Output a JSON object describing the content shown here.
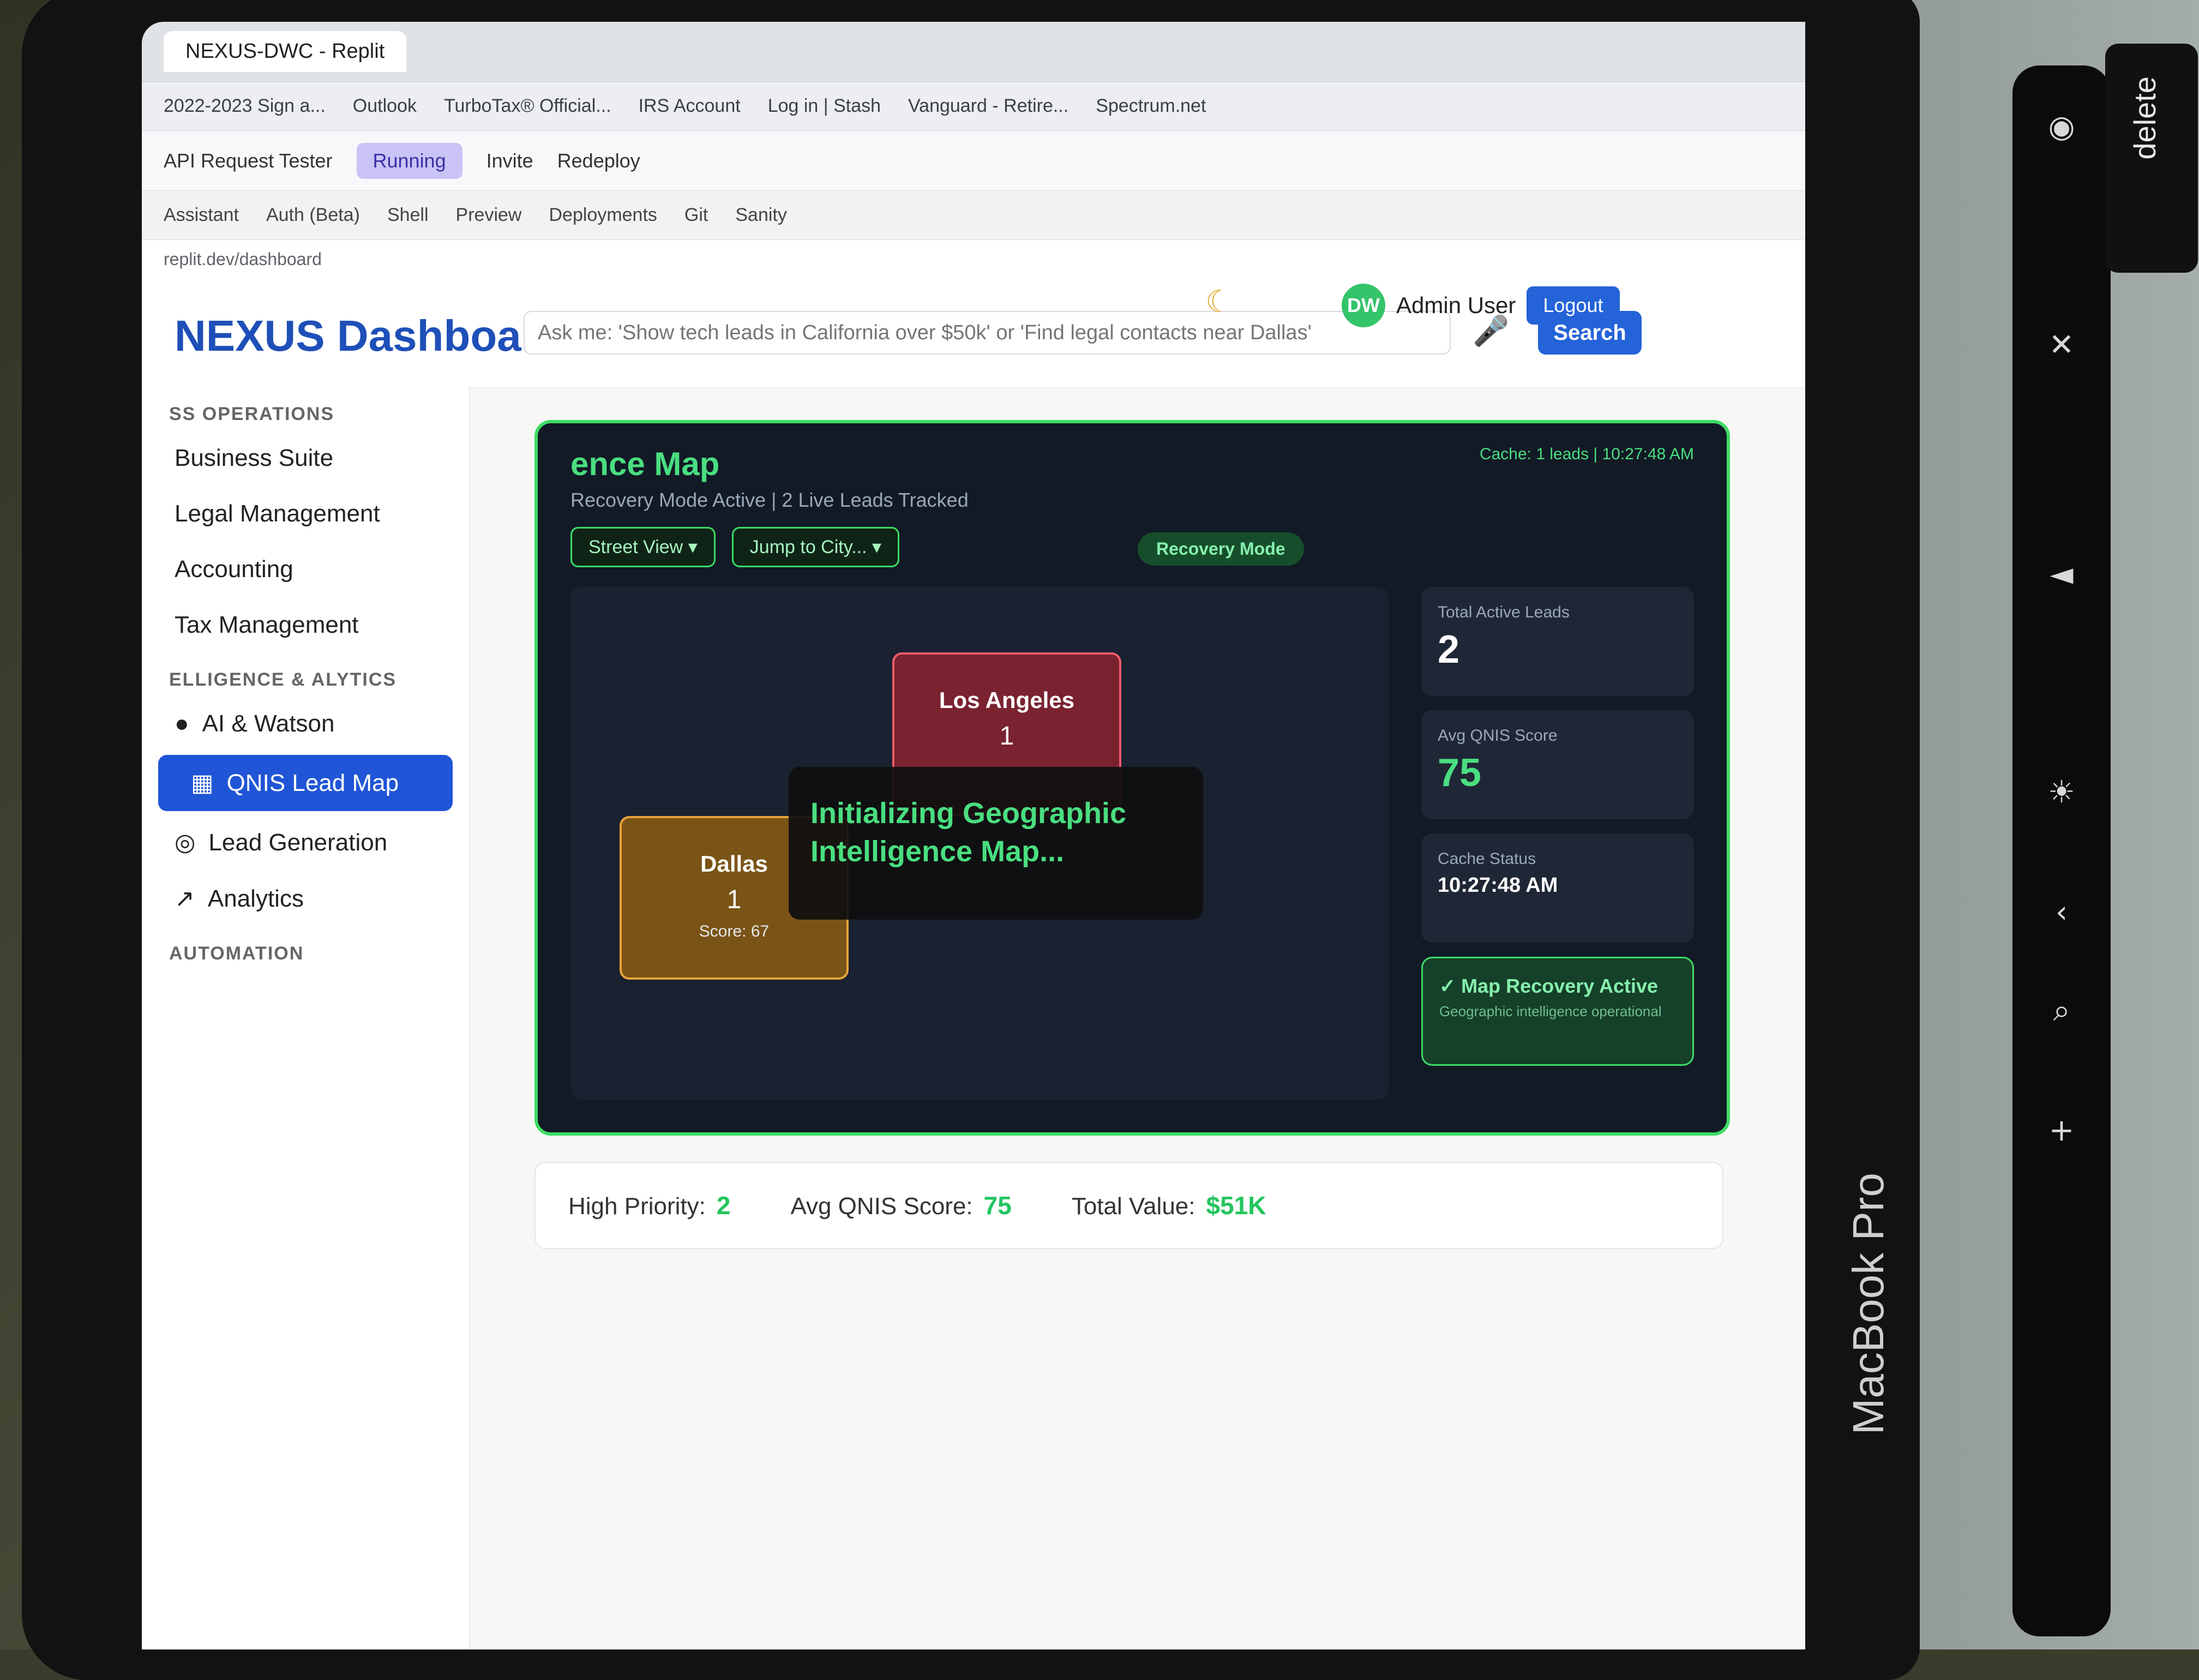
{
  "browser": {
    "tab_title": "NEXUS-DWC - Replit",
    "bookmarks": [
      "2022-2023 Sign a...",
      "Outlook",
      "TurboTax® Official...",
      "IRS Account",
      "Log in | Stash",
      "Vanguard - Retire...",
      "Spectrum.net"
    ],
    "url": "replit.dev/dashboard"
  },
  "replit": {
    "project": "API Request Tester",
    "status": "Running",
    "tabs": [
      "Assistant",
      "Auth (Beta)",
      "Shell",
      "Preview",
      "Deployments",
      "Git",
      "Sanity"
    ],
    "actions": [
      "Invite",
      "Redeploy"
    ]
  },
  "app": {
    "title": "NEXUS Dashboard",
    "search_placeholder": "Ask me: 'Show tech leads in California over $50k' or 'Find legal contacts near Dallas'",
    "search_button": "Search",
    "user_initials": "DW",
    "user_name": "Admin User",
    "logout_label": "Logout"
  },
  "sidebar": {
    "sections": [
      {
        "title": "SS OPERATIONS",
        "items": [
          "Business Suite",
          "Legal Management",
          "Accounting",
          "Tax Management"
        ]
      },
      {
        "title": "ELLIGENCE & ALYTICS",
        "items": [
          "AI & Watson",
          "QNIS Lead Map",
          "Lead Generation",
          "Analytics"
        ]
      },
      {
        "title": "AUTOMATION",
        "items": []
      }
    ],
    "active_item": "QNIS Lead Map"
  },
  "map": {
    "title": "ence Map",
    "subtitle": "Recovery Mode Active | 2 Live Leads Tracked",
    "cache_line": "Cache: 1 leads | 10:27:48 AM",
    "view_select": "Street View",
    "jump_select": "Jump to City...",
    "mode_badge": "Recovery Mode",
    "cities": [
      {
        "name": "Dallas",
        "count": "1",
        "score": "Score: 67"
      },
      {
        "name": "Los Angeles",
        "count": "1",
        "score": ""
      }
    ],
    "overlay_text": "Initializing Geographic Intelligence Map...",
    "stats": [
      {
        "label": "Total Active Leads",
        "value": "2"
      },
      {
        "label": "Avg QNIS Score",
        "value": "75"
      },
      {
        "label": "Cache Status",
        "value": "10:27:48 AM"
      }
    ],
    "recovery_title": "✓ Map Recovery Active",
    "recovery_sub": "Geographic intelligence operational"
  },
  "summary": {
    "high_priority_label": "High Priority:",
    "high_priority_value": "2",
    "avg_score_label": "Avg QNIS Score:",
    "avg_score_value": "75",
    "total_value_label": "Total Value:",
    "total_value_value": "$51K"
  },
  "device": {
    "brand": "MacBook Pro",
    "delete_key": "delete"
  }
}
